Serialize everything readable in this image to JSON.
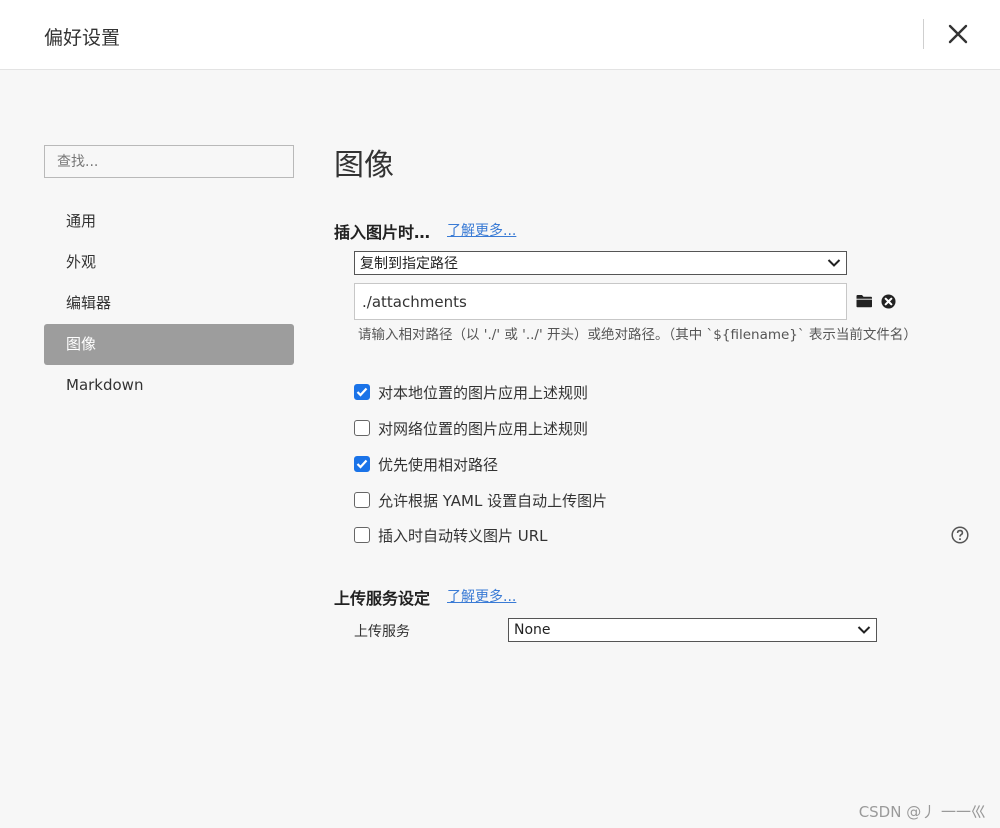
{
  "window": {
    "title": "偏好设置"
  },
  "sidebar": {
    "search_placeholder": "查找...",
    "items": [
      {
        "label": "通用",
        "active": false
      },
      {
        "label": "外观",
        "active": false
      },
      {
        "label": "编辑器",
        "active": false
      },
      {
        "label": "图像",
        "active": true
      },
      {
        "label": "Markdown",
        "active": false
      }
    ]
  },
  "main": {
    "title": "图像",
    "insert_section": {
      "heading": "插入图片时…",
      "learn_more": "了解更多...",
      "action_select": "复制到指定路径",
      "path_value": "./attachments",
      "hint": "请输入相对路径（以 './' 或 '../' 开头）或绝对路径。（其中 `${filename}` 表示当前文件名）",
      "options": [
        {
          "label": "对本地位置的图片应用上述规则",
          "checked": true
        },
        {
          "label": "对网络位置的图片应用上述规则",
          "checked": false
        },
        {
          "label": "优先使用相对路径",
          "checked": true
        },
        {
          "label": "允许根据 YAML 设置自动上传图片",
          "checked": false
        },
        {
          "label": "插入时自动转义图片 URL",
          "checked": false
        }
      ]
    },
    "upload_section": {
      "heading": "上传服务设定",
      "learn_more": "了解更多...",
      "service_label": "上传服务",
      "service_select": "None"
    }
  },
  "watermark": "CSDN @丿 一一巛",
  "colors": {
    "accent": "#1a73e8",
    "active_nav": "#9d9d9d",
    "link": "#3a7bd5"
  }
}
